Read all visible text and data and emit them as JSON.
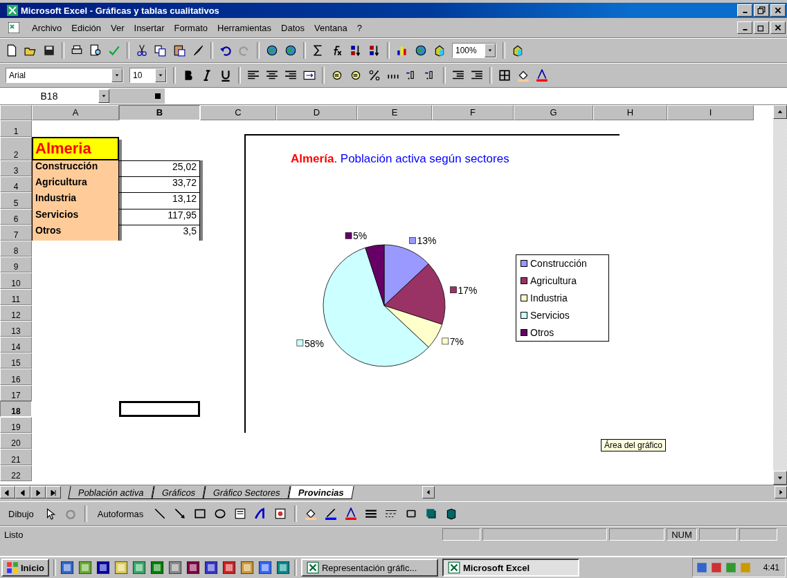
{
  "window": {
    "title": "Microsoft Excel - Gráficas y tablas cualitativos"
  },
  "menu": [
    "Archivo",
    "Edición",
    "Ver",
    "Insertar",
    "Formato",
    "Herramientas",
    "Datos",
    "Ventana",
    "?"
  ],
  "formatting": {
    "font": "Arial",
    "size": "10"
  },
  "zoom": "100%",
  "name_box": "B18",
  "columns": [
    {
      "label": "A",
      "selected": false
    },
    {
      "label": "B",
      "selected": true
    },
    {
      "label": "C",
      "selected": false
    },
    {
      "label": "D",
      "selected": false
    },
    {
      "label": "E",
      "selected": false
    },
    {
      "label": "F",
      "selected": false
    },
    {
      "label": "G",
      "selected": false
    },
    {
      "label": "H",
      "selected": false
    },
    {
      "label": "I",
      "selected": false
    }
  ],
  "rows": [
    {
      "label": "1",
      "selected": false
    },
    {
      "label": "2",
      "selected": false
    },
    {
      "label": "3",
      "selected": false
    },
    {
      "label": "4",
      "selected": false
    },
    {
      "label": "5",
      "selected": false
    },
    {
      "label": "6",
      "selected": false
    },
    {
      "label": "7",
      "selected": false
    },
    {
      "label": "8",
      "selected": false
    },
    {
      "label": "9",
      "selected": false
    },
    {
      "label": "10",
      "selected": false
    },
    {
      "label": "11",
      "selected": false
    },
    {
      "label": "12",
      "selected": false
    },
    {
      "label": "13",
      "selected": false
    },
    {
      "label": "14",
      "selected": false
    },
    {
      "label": "15",
      "selected": false
    },
    {
      "label": "16",
      "selected": false
    },
    {
      "label": "17",
      "selected": false
    },
    {
      "label": "18",
      "selected": true
    },
    {
      "label": "19",
      "selected": false
    },
    {
      "label": "20",
      "selected": false
    },
    {
      "label": "21",
      "selected": false
    },
    {
      "label": "22",
      "selected": false
    }
  ],
  "table": {
    "title": "Almeria",
    "rows": [
      {
        "label": "Construcción",
        "value": "25,02"
      },
      {
        "label": "Agricultura",
        "value": "33,72"
      },
      {
        "label": "Industria",
        "value": "13,12"
      },
      {
        "label": "Servicios",
        "value": "117,95"
      },
      {
        "label": "Otros",
        "value": "3,5"
      }
    ]
  },
  "chart": {
    "title_place": "Almería",
    "title_rest": ". Población activa según sectores",
    "chart_data": {
      "type": "pie",
      "categories": [
        "Construcción",
        "Agricultura",
        "Industria",
        "Servicios",
        "Otros"
      ],
      "series": [
        {
          "values": [
            13,
            17,
            7,
            58,
            5
          ]
        }
      ],
      "value_labels": [
        "13%",
        "17%",
        "7%",
        "58%",
        "5%"
      ]
    },
    "slices": [
      {
        "color": "#9999ff"
      },
      {
        "color": "#993366"
      },
      {
        "color": "#ffffcc"
      },
      {
        "color": "#ccffff"
      },
      {
        "color": "#660066"
      }
    ]
  },
  "tooltip": "Área del gráfico",
  "sheet_tabs": [
    {
      "label": "Población activa",
      "selected": false
    },
    {
      "label": "Gráficos",
      "selected": false
    },
    {
      "label": "Gráfico Sectores",
      "selected": false
    },
    {
      "label": "Provincias",
      "selected": true
    }
  ],
  "drawing_toolbar": {
    "draw": "Dibujo",
    "autoshapes": "Autoformas"
  },
  "status_bar": {
    "text": "Listo",
    "indicator": "NUM"
  },
  "taskbar": {
    "start": "Inicio",
    "tasks": [
      {
        "label": "Representación gráfic...",
        "selected": false
      },
      {
        "label": "Microsoft Excel",
        "selected": true
      }
    ],
    "clock": "4:41"
  }
}
